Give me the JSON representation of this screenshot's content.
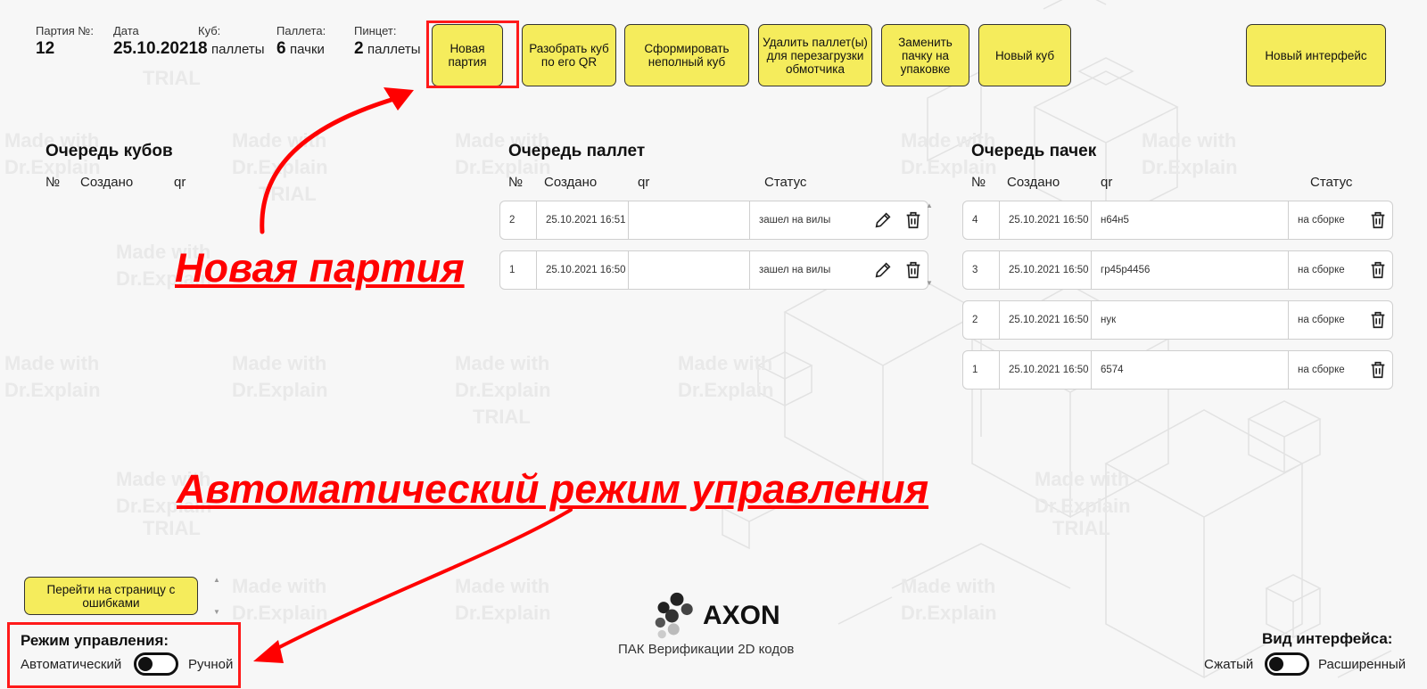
{
  "header": {
    "batch": {
      "label": "Партия №:",
      "value": "12"
    },
    "date": {
      "label": "Дата",
      "value": "25.10.2021"
    },
    "cube": {
      "label": "Куб:",
      "value": "8",
      "unit": "паллеты"
    },
    "pallet": {
      "label": "Паллета:",
      "value": "6",
      "unit": "пачки"
    },
    "tweezers": {
      "label": "Пинцет:",
      "value": "2",
      "unit": "паллеты"
    }
  },
  "toolbar": {
    "new_batch": "Новая партия",
    "disassemble_cube": "Разобрать куб по его QR",
    "form_incomplete_cube": "Сформировать неполный куб",
    "delete_pallets": "Удалить паллет(ы) для перезагрузки обмотчика",
    "replace_pack": "Заменить пачку на упаковке",
    "new_cube": "Новый куб",
    "new_interface": "Новый интерфейс"
  },
  "cube_queue": {
    "title": "Очередь кубов",
    "columns": [
      "№",
      "Создано",
      "qr"
    ]
  },
  "pallet_queue": {
    "title": "Очередь паллет",
    "columns": [
      "№",
      "Создано",
      "qr",
      "Статус"
    ],
    "rows": [
      {
        "num": "2",
        "created": "25.10.2021 16:51",
        "qr": "",
        "status": "зашел на вилы"
      },
      {
        "num": "1",
        "created": "25.10.2021 16:50",
        "qr": "",
        "status": "зашел на вилы"
      }
    ]
  },
  "pack_queue": {
    "title": "Очередь пачек",
    "columns": [
      "№",
      "Создано",
      "qr",
      "Статус"
    ],
    "rows": [
      {
        "num": "4",
        "created": "25.10.2021 16:50",
        "qr": "н64н5",
        "status": "на сборке"
      },
      {
        "num": "3",
        "created": "25.10.2021 16:50",
        "qr": "гр45р4456",
        "status": "на сборке"
      },
      {
        "num": "2",
        "created": "25.10.2021 16:50",
        "qr": "нук",
        "status": "на сборке"
      },
      {
        "num": "1",
        "created": "25.10.2021 16:50",
        "qr": "6574",
        "status": "на сборке"
      }
    ]
  },
  "errors_button": "Перейти на страницу с ошибками",
  "control_mode": {
    "title": "Режим управления:",
    "left": "Автоматический",
    "right": "Ручной",
    "state": "Автоматический"
  },
  "brand": {
    "name": "AXON",
    "subtitle": "ПАК Верификации 2D кодов"
  },
  "view_mode": {
    "title": "Вид интерфейса:",
    "left": "Сжатый",
    "right": "Расширенный",
    "state": "Сжатый"
  },
  "annotations": {
    "new_batch": "Новая партия",
    "auto_mode": "Автоматический режим управления",
    "color": "#ff0000"
  },
  "icons": [
    "pencil-icon",
    "trash-icon",
    "axon-logo-icon",
    "scroll-up-icon",
    "scroll-down-icon"
  ]
}
